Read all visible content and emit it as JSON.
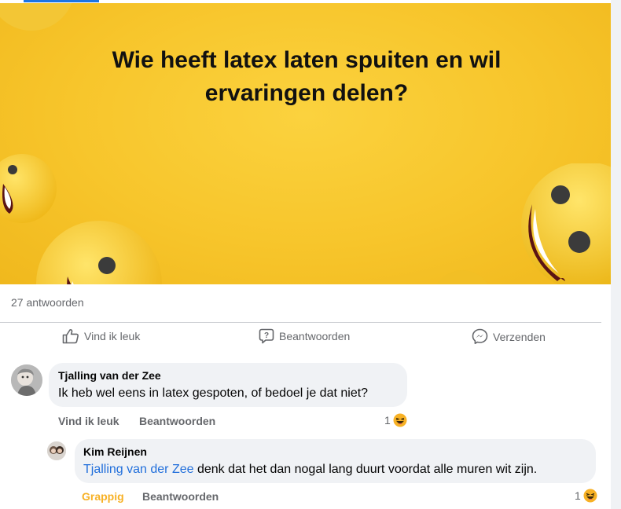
{
  "post": {
    "banner_title_line1": "Wie heeft latex laten spuiten en wil",
    "banner_title_line2": "ervaringen delen?",
    "banner_color": "#f7c52b"
  },
  "stats": {
    "reply_count": "27 antwoorden"
  },
  "actions": {
    "like_label": "Vind ik leuk",
    "reply_label": "Beantwoorden",
    "send_label": "Verzenden"
  },
  "comments": [
    {
      "author": "Tjalling van der Zee",
      "text": "Ik heb wel eens in latex gespoten, of bedoel je dat niet?",
      "like_label": "Vind ik leuk",
      "reply_label": "Beantwoorden",
      "reaction_count": "1",
      "reaction_icon": "haha-emoji-icon"
    },
    {
      "author": "Kim Reijnen",
      "mention": "Tjalling van der Zee",
      "text": " denk dat het dan nogal lang duurt voordat alle muren wit zijn.",
      "reaction_label": "Grappig",
      "reaction_label_color": "#f7b125",
      "reply_label": "Beantwoorden",
      "reaction_count": "1",
      "reaction_icon": "haha-emoji-icon"
    }
  ]
}
